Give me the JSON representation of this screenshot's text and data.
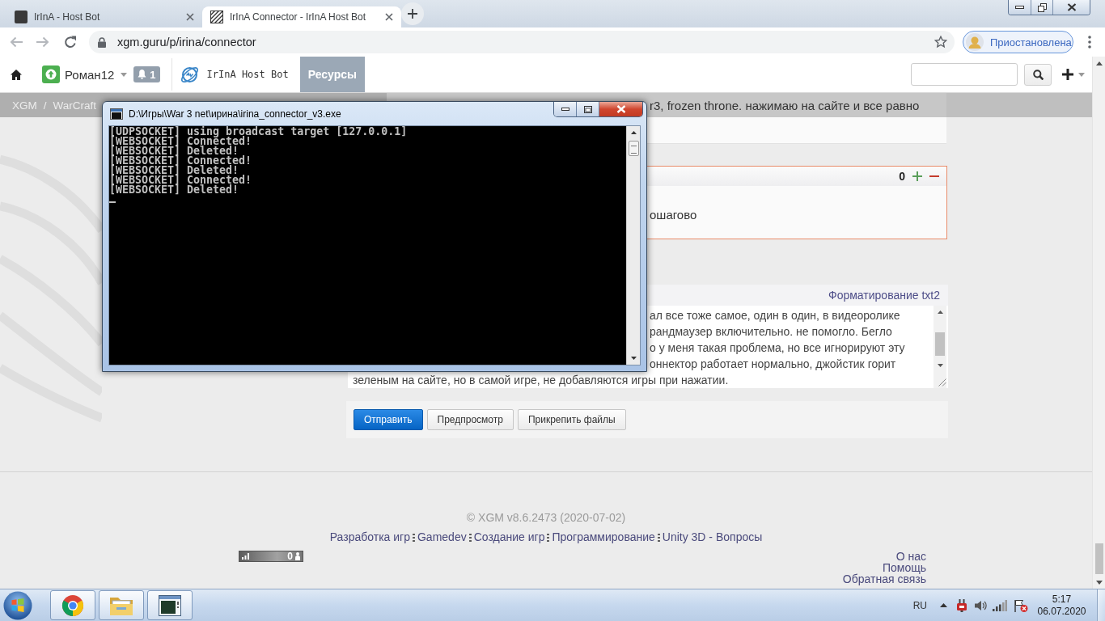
{
  "browser": {
    "tabs": [
      {
        "title": "IrInA - Host Bot",
        "kind": "photo",
        "selected": false
      },
      {
        "title": "IrInA Connector - IrInA Host Bot",
        "kind": "pattern",
        "selected": true
      }
    ],
    "url": "xgm.guru/p/irina/connector",
    "profile_status": "Приостановлена"
  },
  "site_nav": {
    "username": "Роман12",
    "notifications": "1",
    "project": "IrInA Host Bot",
    "tabs": [
      {
        "label": "Ресурсы",
        "selected": true
      }
    ]
  },
  "breadcrumb": {
    "items": [
      "XGM",
      "WarCraft"
    ],
    "separator": "/"
  },
  "post": {
    "text": "r3, frozen throne. нажимаю на сайте и все равно"
  },
  "comment": {
    "score": "0",
    "text": "ошагово"
  },
  "reply_form": {
    "formatting_link": "Форматирование txt2",
    "text_lines": [
      {
        "text": "ал все тоже самое, один в один, в видеоролике",
        "kind": "cut"
      },
      {
        "text": "рандмаузер включительно. не помогло. Бегло",
        "kind": "cut"
      },
      {
        "text": "о у меня такая проблема, но все игнорируют эту",
        "kind": "cut"
      },
      {
        "text": "оннектор работает нормально, джойстик горит",
        "kind": "cut"
      },
      {
        "text": "зеленым на сайте, но в самой игре, не добавляются игры при нажатии.",
        "kind": "whole"
      }
    ],
    "buttons": [
      {
        "label": "Отправить",
        "kind": "primary"
      },
      {
        "label": "Предпросмотр",
        "kind": "secondary"
      },
      {
        "label": "Прикрепить файлы",
        "kind": "secondary"
      }
    ]
  },
  "footer": {
    "copyright": "© XGM v8.6.2473 (2020-07-02)",
    "links": [
      "Разработка игр",
      "Gamedev",
      "Создание игр",
      "Программирование",
      "Unity 3D - Вопросы"
    ],
    "online_count": "0",
    "side_links": [
      "О нас",
      "Помощь",
      "Обратная связь"
    ]
  },
  "console": {
    "title": "D:\\Игры\\War 3 net\\ирина\\irina_connector_v3.exe",
    "lines": [
      "[UDPSOCKET] using broadcast target [127.0.0.1]",
      "[WEBSOCKET] Connected!",
      "[WEBSOCKET] Deleted!",
      "[WEBSOCKET] Connected!",
      "[WEBSOCKET] Deleted!",
      "[WEBSOCKET] Connected!",
      "[WEBSOCKET] Deleted!"
    ]
  },
  "taskbar": {
    "apps": [
      {
        "kind": "browser"
      },
      {
        "kind": "folder"
      },
      {
        "kind": "console"
      }
    ],
    "language": "RU",
    "time": "5:17",
    "date": "06.07.2020"
  }
}
